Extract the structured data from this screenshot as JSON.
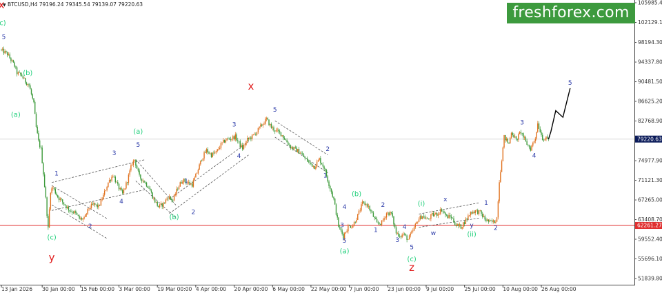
{
  "header": {
    "symbol_text": "BTCUSD,H4",
    "ohlc_text": "79196.24 79345.54 79139.07 79220.63"
  },
  "logo": {
    "text": "freshforex.com",
    "color": "#3d9a3e"
  },
  "colors": {
    "bull": "#e0701c",
    "bear": "#3c9a3a",
    "wave_minor": "#2b3aa8",
    "wave_green": "#1fcf7a",
    "wave_red": "#e01b1b",
    "support_line": "#e03030",
    "current_price_bg": "#0b1b5a",
    "support_tag_bg": "#e03030",
    "forecast": "#000000"
  },
  "chart_data": {
    "type": "candlestick",
    "symbol": "BTCUSD",
    "timeframe": "H4",
    "last_ohlc": {
      "open": 79196.24,
      "high": 79345.54,
      "low": 79139.07,
      "close": 79220.63
    },
    "y_ticks": [
      "105985.40",
      "102129.10",
      "98194.30",
      "94337.80",
      "90481.50",
      "86625.20",
      "82768.90",
      "78912.80",
      "74977.90",
      "71121.30",
      "67265.00",
      "63408.70",
      "59552.40",
      "55696.10",
      "51839.80"
    ],
    "ylim": [
      51839.8,
      105985.4
    ],
    "x_ticks": [
      "13 Jan 2026",
      "30 Jan 00:00",
      "15 Feb 00:00",
      "3 Mar 00:00",
      "19 Mar 00:00",
      "4 Apr 00:00",
      "20 Apr 00:00",
      "6 May 00:00",
      "22 May 00:00",
      "7 Jun 00:00",
      "23 Jun 00:00",
      "9 Jul 00:00",
      "25 Jul 00:00",
      "10 Aug 00:00",
      "26 Aug 00:00"
    ],
    "current_price": "79220.63",
    "support_level": "62261.27",
    "price_path": [
      [
        "13 Jan 2026",
        96800
      ],
      [
        "16 Jan 2026",
        95900
      ],
      [
        "19 Jan 2026",
        93600
      ],
      [
        "20 Jan 2026",
        92200
      ],
      [
        "22 Jan 2026",
        91700
      ],
      [
        "23 Jan 2026",
        90800
      ],
      [
        "25 Jan 2026",
        89800
      ],
      [
        "26 Jan 2026",
        88000
      ],
      [
        "27 Jan 2026",
        86100
      ],
      [
        "28 Jan 2026",
        81500
      ],
      [
        "29 Jan 2026",
        78700
      ],
      [
        "30 Jan 2026",
        77200
      ],
      [
        "31 Jan 2026",
        72500
      ],
      [
        "01 Feb 2026",
        67500
      ],
      [
        "02 Feb 2026",
        61600
      ],
      [
        "03 Feb 2026",
        69100
      ],
      [
        "04 Feb 2026",
        69700
      ],
      [
        "06 Feb 2026",
        67900
      ],
      [
        "09 Feb 2026",
        66300
      ],
      [
        "11 Feb 2026",
        65200
      ],
      [
        "13 Feb 2026",
        64800
      ],
      [
        "15 Feb 2026",
        63600
      ],
      [
        "17 Feb 2026",
        63500
      ],
      [
        "19 Feb 2026",
        65700
      ],
      [
        "21 Feb 2026",
        66400
      ],
      [
        "23 Feb 2026",
        65900
      ],
      [
        "25 Feb 2026",
        68100
      ],
      [
        "27 Feb 2026",
        70700
      ],
      [
        "01 Mar 2026",
        72200
      ],
      [
        "03 Mar 2026",
        70000
      ],
      [
        "05 Mar 2026",
        68400
      ],
      [
        "07 Mar 2026",
        71100
      ],
      [
        "09 Mar 2026",
        74500
      ],
      [
        "10 Mar 2026",
        75200
      ],
      [
        "12 Mar 2026",
        71800
      ],
      [
        "14 Mar 2026",
        70900
      ],
      [
        "16 Mar 2026",
        69700
      ],
      [
        "18 Mar 2026",
        67400
      ],
      [
        "20 Mar 2026",
        65900
      ],
      [
        "22 Mar 2026",
        66500
      ],
      [
        "24 Mar 2026",
        67900
      ],
      [
        "26 Mar 2026",
        67200
      ],
      [
        "28 Mar 2026",
        69700
      ],
      [
        "30 Mar 2026",
        71200
      ],
      [
        "01 Apr 2026",
        70700
      ],
      [
        "03 Apr 2026",
        70300
      ],
      [
        "05 Apr 2026",
        72600
      ],
      [
        "07 Apr 2026",
        75400
      ],
      [
        "09 Apr 2026",
        77000
      ],
      [
        "11 Apr 2026",
        76100
      ],
      [
        "13 Apr 2026",
        76600
      ],
      [
        "15 Apr 2026",
        78100
      ],
      [
        "17 Apr 2026",
        79100
      ],
      [
        "19 Apr 2026",
        79300
      ],
      [
        "21 Apr 2026",
        79700
      ],
      [
        "23 Apr 2026",
        78000
      ],
      [
        "24 Apr 2026",
        77400
      ],
      [
        "26 Apr 2026",
        79100
      ],
      [
        "28 Apr 2026",
        79700
      ],
      [
        "30 Apr 2026",
        80700
      ],
      [
        "02 May 2026",
        82000
      ],
      [
        "04 May 2026",
        83100
      ],
      [
        "06 May 2026",
        81500
      ],
      [
        "08 May 2026",
        80800
      ],
      [
        "10 May 2026",
        80300
      ],
      [
        "12 May 2026",
        79000
      ],
      [
        "14 May 2026",
        77700
      ],
      [
        "16 May 2026",
        77200
      ],
      [
        "18 May 2026",
        76600
      ],
      [
        "20 May 2026",
        75400
      ],
      [
        "22 May 2026",
        74500
      ],
      [
        "24 May 2026",
        73800
      ],
      [
        "26 May 2026",
        75300
      ],
      [
        "28 May 2026",
        73600
      ],
      [
        "30 May 2026",
        70400
      ],
      [
        "01 Jun 2026",
        67400
      ],
      [
        "03 Jun 2026",
        62100
      ],
      [
        "05 Jun 2026",
        60200
      ],
      [
        "07 Jun 2026",
        62000
      ],
      [
        "09 Jun 2026",
        62300
      ],
      [
        "11 Jun 2026",
        64200
      ],
      [
        "13 Jun 2026",
        66600
      ],
      [
        "15 Jun 2026",
        66300
      ],
      [
        "17 Jun 2026",
        64500
      ],
      [
        "19 Jun 2026",
        62600
      ],
      [
        "21 Jun 2026",
        62800
      ],
      [
        "23 Jun 2026",
        64700
      ],
      [
        "25 Jun 2026",
        64600
      ],
      [
        "27 Jun 2026",
        60800
      ],
      [
        "29 Jun 2026",
        60200
      ],
      [
        "30 Jun 2026",
        60600
      ],
      [
        "02 Jul 2026",
        59500
      ],
      [
        "04 Jul 2026",
        61200
      ],
      [
        "06 Jul 2026",
        63300
      ],
      [
        "08 Jul 2026",
        64200
      ],
      [
        "10 Jul 2026",
        63300
      ],
      [
        "12 Jul 2026",
        64300
      ],
      [
        "14 Jul 2026",
        64500
      ],
      [
        "16 Jul 2026",
        65400
      ],
      [
        "18 Jul 2026",
        64000
      ],
      [
        "20 Jul 2026",
        63900
      ],
      [
        "22 Jul 2026",
        62300
      ],
      [
        "24 Jul 2026",
        62000
      ],
      [
        "26 Jul 2026",
        63300
      ],
      [
        "28 Jul 2026",
        64800
      ],
      [
        "30 Jul 2026",
        65100
      ],
      [
        "01 Aug 2026",
        64800
      ],
      [
        "03 Aug 2026",
        63500
      ],
      [
        "05 Aug 2026",
        62900
      ],
      [
        "07 Aug 2026",
        63000
      ],
      [
        "08 Aug 2026",
        63800
      ],
      [
        "09 Aug 2026",
        71000
      ],
      [
        "10 Aug 2026",
        75300
      ],
      [
        "11 Aug 2026",
        79600
      ],
      [
        "13 Aug 2026",
        78300
      ],
      [
        "14 Aug 2026",
        80700
      ],
      [
        "16 Aug 2026",
        79000
      ],
      [
        "18 Aug 2026",
        80700
      ],
      [
        "20 Aug 2026",
        78600
      ],
      [
        "22 Aug 2026",
        77300
      ],
      [
        "24 Aug 2026",
        79500
      ],
      [
        "25 Aug 2026",
        82300
      ],
      [
        "27 Aug 2026",
        79400
      ],
      [
        "29 Aug 2026",
        79200
      ]
    ],
    "forecast_path": [
      [
        "29 Aug 2026",
        79200
      ],
      [
        "30 Aug 2026",
        80700
      ],
      [
        "01 Sep 2026",
        84800
      ],
      [
        "04 Sep 2026",
        83500
      ],
      [
        "07 Sep 2026",
        89200
      ]
    ],
    "channels": [
      {
        "kind": "rising",
        "from": [
          "03 Feb 2026",
          70700
        ],
        "to": [
          "14 Mar 2026",
          75200
        ],
        "parallel_from": [
          "03 Feb 2026",
          65200
        ],
        "parallel_to": [
          "14 Mar 2026",
          69300
        ]
      },
      {
        "kind": "falling",
        "from": [
          "03 Feb 2026",
          70100
        ],
        "to": [
          "26 Feb 2026",
          63600
        ],
        "parallel_from": [
          "03 Feb 2026",
          66300
        ],
        "parallel_to": [
          "26 Feb 2026",
          59700
        ]
      },
      {
        "kind": "falling",
        "from": [
          "10 Mar 2026",
          75200
        ],
        "to": [
          "27 Mar 2026",
          66100
        ],
        "parallel_from": [
          "10 Mar 2026",
          71000
        ],
        "parallel_to": [
          "27 Mar 2026",
          63600
        ]
      },
      {
        "kind": "rising",
        "from": [
          "24 Mar 2026",
          67400
        ],
        "to": [
          "26 Apr 2026",
          78700
        ],
        "parallel_from": [
          "24 Mar 2026",
          64600
        ],
        "parallel_to": [
          "26 Apr 2026",
          76100
        ]
      },
      {
        "kind": "falling",
        "from": [
          "07 May 2026",
          82800
        ],
        "to": [
          "29 May 2026",
          76100
        ],
        "parallel_from": [
          "07 May 2026",
          79600
        ],
        "parallel_to": [
          "29 May 2026",
          72600
        ]
      },
      {
        "kind": "rising",
        "from": [
          "06 Jul 2026",
          64500
        ],
        "to": [
          "31 Jul 2026",
          66700
        ],
        "parallel_from": [
          "06 Jul 2026",
          61900
        ],
        "parallel_to": [
          "31 Jul 2026",
          63700
        ]
      }
    ],
    "wave_labels": [
      {
        "text": "x",
        "date": "13 Jan 2026",
        "price": 104900,
        "style": "red"
      },
      {
        "text": "(c)",
        "date": "13 Jan 2026",
        "price": 101600,
        "style": "green"
      },
      {
        "text": "5",
        "date": "14 Jan 2026",
        "price": 98900,
        "style": "blue"
      },
      {
        "text": "(b)",
        "date": "24 Jan 2026",
        "price": 91800,
        "style": "green"
      },
      {
        "text": "(a)",
        "date": "19 Jan 2026",
        "price": 83600,
        "style": "green"
      },
      {
        "text": "1",
        "date": "05 Feb 2026",
        "price": 72100,
        "style": "blue"
      },
      {
        "text": "2",
        "date": "19 Feb 2026",
        "price": 61700,
        "style": "blue"
      },
      {
        "text": "3",
        "date": "01 Mar 2026",
        "price": 76100,
        "style": "blue"
      },
      {
        "text": "4",
        "date": "04 Mar 2026",
        "price": 66600,
        "style": "blue"
      },
      {
        "text": "5",
        "date": "11 Mar 2026",
        "price": 77700,
        "style": "blue"
      },
      {
        "text": "(a)",
        "date": "11 Mar 2026",
        "price": 80300,
        "style": "green"
      },
      {
        "text": "(c)",
        "date": "03 Feb 2026",
        "price": 59500,
        "style": "green"
      },
      {
        "text": "y",
        "date": "03 Feb 2026",
        "price": 55300,
        "style": "red"
      },
      {
        "text": "1",
        "date": "31 Mar 2026",
        "price": 70600,
        "style": "blue"
      },
      {
        "text": "2",
        "date": "03 Apr 2026",
        "price": 64500,
        "style": "blue"
      },
      {
        "text": "(b)",
        "date": "26 Mar 2026",
        "price": 63500,
        "style": "green"
      },
      {
        "text": "3",
        "date": "20 Apr 2026",
        "price": 81700,
        "style": "blue"
      },
      {
        "text": "4",
        "date": "22 Apr 2026",
        "price": 75500,
        "style": "blue"
      },
      {
        "text": "x",
        "date": "27 Apr 2026",
        "price": 88900,
        "style": "red"
      },
      {
        "text": "5",
        "date": "07 May 2026",
        "price": 84600,
        "style": "blue"
      },
      {
        "text": "2",
        "date": "29 May 2026",
        "price": 76900,
        "style": "blue"
      },
      {
        "text": "1",
        "date": "28 May 2026",
        "price": 71700,
        "style": "blue"
      },
      {
        "text": "(b)",
        "date": "10 Jun 2026",
        "price": 68000,
        "style": "green"
      },
      {
        "text": "4",
        "date": "05 Jun 2026",
        "price": 65500,
        "style": "blue"
      },
      {
        "text": "3",
        "date": "04 Jun 2026",
        "price": 61900,
        "style": "blue"
      },
      {
        "text": "5",
        "date": "05 Jun 2026",
        "price": 58900,
        "style": "blue"
      },
      {
        "text": "(a)",
        "date": "05 Jun 2026",
        "price": 56800,
        "style": "green"
      },
      {
        "text": "2",
        "date": "21 Jun 2026",
        "price": 65900,
        "style": "blue"
      },
      {
        "text": "1",
        "date": "18 Jun 2026",
        "price": 61000,
        "style": "blue"
      },
      {
        "text": "4",
        "date": "30 Jun 2026",
        "price": 61600,
        "style": "blue"
      },
      {
        "text": "3",
        "date": "27 Jun 2026",
        "price": 59000,
        "style": "blue"
      },
      {
        "text": "5",
        "date": "03 Jul 2026",
        "price": 57600,
        "style": "blue"
      },
      {
        "text": "(c)",
        "date": "03 Jul 2026",
        "price": 55200,
        "style": "green"
      },
      {
        "text": "z",
        "date": "03 Jul 2026",
        "price": 53300,
        "style": "red"
      },
      {
        "text": "(i)",
        "date": "07 Jul 2026",
        "price": 66100,
        "style": "green"
      },
      {
        "text": "w",
        "date": "12 Jul 2026",
        "price": 60400,
        "style": "blue"
      },
      {
        "text": "x",
        "date": "17 Jul 2026",
        "price": 67000,
        "style": "blue"
      },
      {
        "text": "y",
        "date": "28 Jul 2026",
        "price": 61900,
        "style": "blue"
      },
      {
        "text": "(ii)",
        "date": "28 Jul 2026",
        "price": 60100,
        "style": "green"
      },
      {
        "text": "1",
        "date": "03 Aug 2026",
        "price": 66300,
        "style": "blue"
      },
      {
        "text": "2",
        "date": "07 Aug 2026",
        "price": 61400,
        "style": "blue"
      },
      {
        "text": "3",
        "date": "18 Aug 2026",
        "price": 82100,
        "style": "blue"
      },
      {
        "text": "4",
        "date": "23 Aug 2026",
        "price": 75600,
        "style": "blue"
      },
      {
        "text": "5",
        "date": "07 Sep 2026",
        "price": 89900,
        "style": "blue"
      }
    ]
  }
}
